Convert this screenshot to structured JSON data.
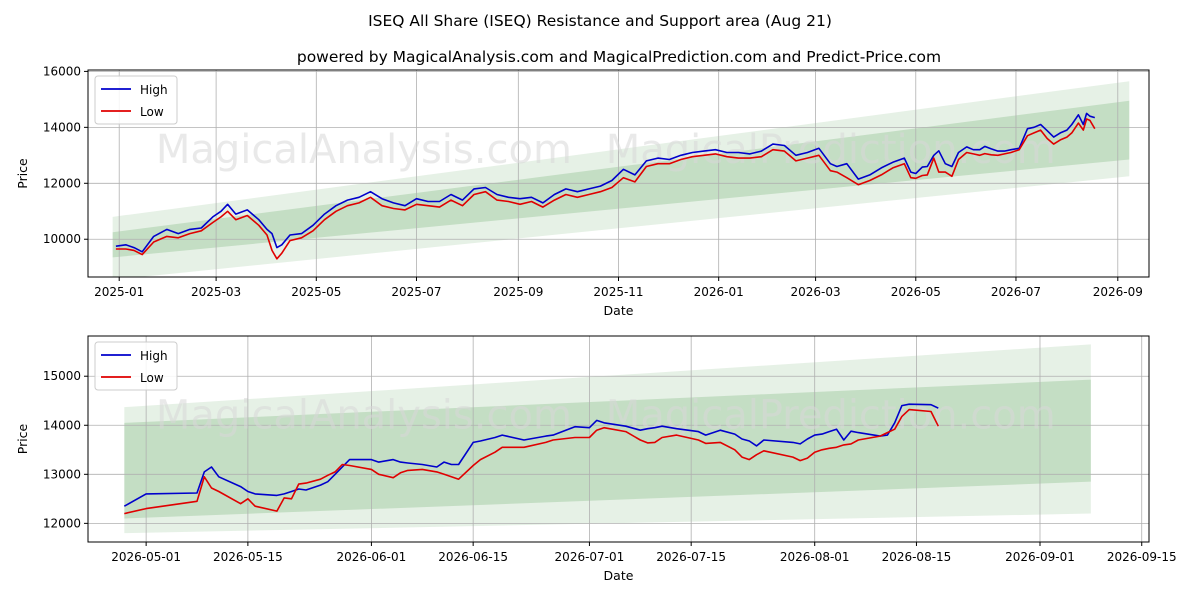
{
  "title": "ISEQ All Share (ISEQ) Resistance and Support area (Aug 21)",
  "subtitle": "powered by MagicalAnalysis.com and MagicalPrediction.com and Predict-Price.com",
  "watermark_left": "MagicalAnalysis.com",
  "watermark_right": "MagicalPrediction.com",
  "colors": {
    "high": "#0000cc",
    "low": "#e00000",
    "band": "#2e8b2e",
    "grid": "#b0b0b0"
  },
  "chart_data": [
    {
      "type": "line",
      "xlabel": "Date",
      "ylabel": "Price",
      "xlim": [
        "2024-12-13",
        "2026-09-20"
      ],
      "ylim": [
        8650,
        16050
      ],
      "xticks": [
        "2025-01",
        "2025-03",
        "2025-05",
        "2025-07",
        "2025-09",
        "2025-11",
        "2026-01",
        "2026-03",
        "2026-05",
        "2026-07",
        "2026-09"
      ],
      "yticks": [
        10000,
        12000,
        14000,
        16000
      ],
      "legend": [
        "High",
        "Low"
      ],
      "legend_position": "upper-left",
      "grid": true,
      "bands": [
        {
          "x": [
            "2024-12-28",
            "2026-09-08"
          ],
          "lower": [
            8550,
            12250
          ],
          "upper": [
            10800,
            15650
          ],
          "opacity": 0.12
        },
        {
          "x": [
            "2024-12-28",
            "2026-09-08"
          ],
          "lower": [
            9350,
            12850
          ],
          "upper": [
            10250,
            14950
          ],
          "opacity": 0.18
        }
      ],
      "series": [
        {
          "name": "High",
          "x": [
            "2024-12-30",
            "2025-01-05",
            "2025-01-10",
            "2025-01-15",
            "2025-01-22",
            "2025-01-30",
            "2025-02-06",
            "2025-02-13",
            "2025-02-20",
            "2025-02-27",
            "2025-03-04",
            "2025-03-08",
            "2025-03-13",
            "2025-03-20",
            "2025-03-27",
            "2025-04-01",
            "2025-04-04",
            "2025-04-07",
            "2025-04-10",
            "2025-04-15",
            "2025-04-22",
            "2025-04-29",
            "2025-05-06",
            "2025-05-13",
            "2025-05-20",
            "2025-05-27",
            "2025-06-03",
            "2025-06-10",
            "2025-06-17",
            "2025-06-24",
            "2025-07-01",
            "2025-07-08",
            "2025-07-15",
            "2025-07-22",
            "2025-07-29",
            "2025-08-05",
            "2025-08-12",
            "2025-08-19",
            "2025-08-26",
            "2025-09-02",
            "2025-09-09",
            "2025-09-16",
            "2025-09-23",
            "2025-09-30",
            "2025-10-07",
            "2025-10-14",
            "2025-10-21",
            "2025-10-28",
            "2025-11-04",
            "2025-11-11",
            "2025-11-18",
            "2025-11-25",
            "2025-12-02",
            "2025-12-09",
            "2025-12-16",
            "2025-12-23",
            "2025-12-30",
            "2026-01-06",
            "2026-01-13",
            "2026-01-20",
            "2026-01-27",
            "2026-02-03",
            "2026-02-10",
            "2026-02-17",
            "2026-02-24",
            "2026-03-03",
            "2026-03-10",
            "2026-03-14",
            "2026-03-20",
            "2026-03-27",
            "2026-04-03",
            "2026-04-10",
            "2026-04-17",
            "2026-04-24",
            "2026-04-28",
            "2026-05-01",
            "2026-05-05",
            "2026-05-08",
            "2026-05-12",
            "2026-05-15",
            "2026-05-19",
            "2026-05-23",
            "2026-05-27",
            "2026-06-01",
            "2026-06-05",
            "2026-06-09",
            "2026-06-12",
            "2026-06-16",
            "2026-06-20",
            "2026-06-24",
            "2026-06-28",
            "2026-07-03",
            "2026-07-08",
            "2026-07-12",
            "2026-07-16",
            "2026-07-20",
            "2026-07-24",
            "2026-07-28",
            "2026-08-01",
            "2026-08-04",
            "2026-08-08",
            "2026-08-11",
            "2026-08-13",
            "2026-08-15",
            "2026-08-18"
          ],
          "values": [
            9750,
            9800,
            9700,
            9550,
            10100,
            10350,
            10200,
            10350,
            10400,
            10800,
            11000,
            11250,
            10900,
            11050,
            10700,
            10350,
            10200,
            9700,
            9800,
            10150,
            10200,
            10500,
            10900,
            11200,
            11400,
            11500,
            11700,
            11450,
            11300,
            11200,
            11450,
            11350,
            11350,
            11600,
            11400,
            11800,
            11850,
            11600,
            11500,
            11450,
            11500,
            11300,
            11600,
            11800,
            11700,
            11800,
            11900,
            12100,
            12500,
            12300,
            12800,
            12900,
            12850,
            13000,
            13100,
            13150,
            13200,
            13100,
            13100,
            13050,
            13150,
            13400,
            13350,
            13000,
            13100,
            13250,
            12700,
            12600,
            12700,
            12150,
            12300,
            12550,
            12750,
            12900,
            12400,
            12350,
            12580,
            12600,
            13000,
            13160,
            12700,
            12600,
            13100,
            13300,
            13200,
            13200,
            13320,
            13230,
            13150,
            13150,
            13200,
            13250,
            13950,
            14000,
            14100,
            13880,
            13650,
            13800,
            13900,
            14100,
            14450,
            14100,
            14500,
            14400,
            14350
          ]
        },
        {
          "name": "Low",
          "x": [
            "2024-12-30",
            "2025-01-05",
            "2025-01-10",
            "2025-01-15",
            "2025-01-22",
            "2025-01-30",
            "2025-02-06",
            "2025-02-13",
            "2025-02-20",
            "2025-02-27",
            "2025-03-04",
            "2025-03-08",
            "2025-03-13",
            "2025-03-20",
            "2025-03-27",
            "2025-04-01",
            "2025-04-04",
            "2025-04-07",
            "2025-04-10",
            "2025-04-15",
            "2025-04-22",
            "2025-04-29",
            "2025-05-06",
            "2025-05-13",
            "2025-05-20",
            "2025-05-27",
            "2025-06-03",
            "2025-06-10",
            "2025-06-17",
            "2025-06-24",
            "2025-07-01",
            "2025-07-08",
            "2025-07-15",
            "2025-07-22",
            "2025-07-29",
            "2025-08-05",
            "2025-08-12",
            "2025-08-19",
            "2025-08-26",
            "2025-09-02",
            "2025-09-09",
            "2025-09-16",
            "2025-09-23",
            "2025-09-30",
            "2025-10-07",
            "2025-10-14",
            "2025-10-21",
            "2025-10-28",
            "2025-11-04",
            "2025-11-11",
            "2025-11-18",
            "2025-11-25",
            "2025-12-02",
            "2025-12-09",
            "2025-12-16",
            "2025-12-23",
            "2025-12-30",
            "2026-01-06",
            "2026-01-13",
            "2026-01-20",
            "2026-01-27",
            "2026-02-03",
            "2026-02-10",
            "2026-02-17",
            "2026-02-24",
            "2026-03-03",
            "2026-03-10",
            "2026-03-14",
            "2026-03-20",
            "2026-03-27",
            "2026-04-03",
            "2026-04-10",
            "2026-04-17",
            "2026-04-24",
            "2026-04-28",
            "2026-05-01",
            "2026-05-05",
            "2026-05-08",
            "2026-05-12",
            "2026-05-15",
            "2026-05-19",
            "2026-05-23",
            "2026-05-27",
            "2026-06-01",
            "2026-06-05",
            "2026-06-09",
            "2026-06-12",
            "2026-06-16",
            "2026-06-20",
            "2026-06-24",
            "2026-06-28",
            "2026-07-03",
            "2026-07-08",
            "2026-07-12",
            "2026-07-16",
            "2026-07-20",
            "2026-07-24",
            "2026-07-28",
            "2026-08-01",
            "2026-08-04",
            "2026-08-08",
            "2026-08-11",
            "2026-08-13",
            "2026-08-15",
            "2026-08-18"
          ],
          "values": [
            9650,
            9650,
            9600,
            9450,
            9900,
            10100,
            10050,
            10200,
            10300,
            10600,
            10800,
            11000,
            10700,
            10850,
            10500,
            10150,
            9600,
            9300,
            9500,
            9950,
            10050,
            10300,
            10700,
            11000,
            11200,
            11300,
            11500,
            11200,
            11100,
            11050,
            11250,
            11200,
            11150,
            11400,
            11200,
            11600,
            11700,
            11400,
            11350,
            11250,
            11350,
            11150,
            11400,
            11600,
            11500,
            11600,
            11700,
            11850,
            12200,
            12050,
            12600,
            12700,
            12700,
            12850,
            12950,
            13000,
            13050,
            12950,
            12900,
            12900,
            12950,
            13200,
            13150,
            12800,
            12900,
            13000,
            12450,
            12400,
            12200,
            11950,
            12100,
            12300,
            12550,
            12700,
            12200,
            12180,
            12280,
            12300,
            12900,
            12400,
            12400,
            12250,
            12850,
            13100,
            13050,
            13000,
            13060,
            13020,
            13000,
            13050,
            13100,
            13200,
            13700,
            13800,
            13900,
            13600,
            13400,
            13550,
            13650,
            13800,
            14150,
            13900,
            14300,
            14250,
            13950
          ]
        }
      ]
    },
    {
      "type": "line",
      "xlabel": "Date",
      "ylabel": "Price",
      "xlim": [
        "2026-04-23",
        "2026-09-16"
      ],
      "ylim": [
        11620,
        15820
      ],
      "xticks": [
        "2026-05-01",
        "2026-05-15",
        "2026-06-01",
        "2026-06-15",
        "2026-07-01",
        "2026-07-15",
        "2026-08-01",
        "2026-08-15",
        "2026-09-01",
        "2026-09-15"
      ],
      "yticks": [
        12000,
        13000,
        14000,
        15000
      ],
      "legend": [
        "High",
        "Low"
      ],
      "legend_position": "upper-left",
      "grid": true,
      "bands": [
        {
          "x": [
            "2026-04-28",
            "2026-09-08"
          ],
          "lower": [
            11800,
            12200
          ],
          "upper": [
            14370,
            15650
          ],
          "opacity": 0.12
        },
        {
          "x": [
            "2026-04-28",
            "2026-09-08"
          ],
          "lower": [
            12100,
            12850
          ],
          "upper": [
            14050,
            14930
          ],
          "opacity": 0.18
        }
      ],
      "series": [
        {
          "name": "High",
          "x": [
            "2026-04-28",
            "2026-05-01",
            "2026-05-08",
            "2026-05-09",
            "2026-05-10",
            "2026-05-11",
            "2026-05-14",
            "2026-05-15",
            "2026-05-16",
            "2026-05-19",
            "2026-05-20",
            "2026-05-21",
            "2026-05-22",
            "2026-05-23",
            "2026-05-25",
            "2026-05-26",
            "2026-05-27",
            "2026-05-28",
            "2026-05-29",
            "2026-06-01",
            "2026-06-02",
            "2026-06-04",
            "2026-06-05",
            "2026-06-06",
            "2026-06-08",
            "2026-06-10",
            "2026-06-11",
            "2026-06-12",
            "2026-06-13",
            "2026-06-15",
            "2026-06-16",
            "2026-06-18",
            "2026-06-19",
            "2026-06-22",
            "2026-06-25",
            "2026-06-26",
            "2026-06-29",
            "2026-07-01",
            "2026-07-02",
            "2026-07-03",
            "2026-07-06",
            "2026-07-08",
            "2026-07-09",
            "2026-07-10",
            "2026-07-11",
            "2026-07-13",
            "2026-07-16",
            "2026-07-17",
            "2026-07-19",
            "2026-07-21",
            "2026-07-22",
            "2026-07-23",
            "2026-07-24",
            "2026-07-25",
            "2026-07-29",
            "2026-07-30",
            "2026-07-31",
            "2026-08-01",
            "2026-08-02",
            "2026-08-03",
            "2026-08-04",
            "2026-08-05",
            "2026-08-06",
            "2026-08-07",
            "2026-08-10",
            "2026-08-11",
            "2026-08-12",
            "2026-08-13",
            "2026-08-14",
            "2026-08-17",
            "2026-08-18"
          ],
          "values": [
            12350,
            12600,
            12620,
            13050,
            13150,
            12950,
            12750,
            12650,
            12600,
            12570,
            12600,
            12650,
            12700,
            12680,
            12780,
            12850,
            13000,
            13150,
            13300,
            13300,
            13250,
            13300,
            13250,
            13230,
            13200,
            13150,
            13250,
            13200,
            13200,
            13650,
            13680,
            13750,
            13800,
            13700,
            13780,
            13800,
            13970,
            13950,
            14100,
            14050,
            13980,
            13900,
            13930,
            13950,
            13980,
            13930,
            13870,
            13800,
            13900,
            13820,
            13720,
            13680,
            13580,
            13700,
            13650,
            13620,
            13720,
            13800,
            13820,
            13870,
            13920,
            13700,
            13880,
            13850,
            13780,
            13800,
            14050,
            14400,
            14430,
            14420,
            14350
          ]
        },
        {
          "name": "Low",
          "x": [
            "2026-04-28",
            "2026-05-01",
            "2026-05-08",
            "2026-05-09",
            "2026-05-10",
            "2026-05-11",
            "2026-05-14",
            "2026-05-15",
            "2026-05-16",
            "2026-05-19",
            "2026-05-20",
            "2026-05-21",
            "2026-05-22",
            "2026-05-23",
            "2026-05-25",
            "2026-05-26",
            "2026-05-27",
            "2026-05-28",
            "2026-05-29",
            "2026-06-01",
            "2026-06-02",
            "2026-06-04",
            "2026-06-05",
            "2026-06-06",
            "2026-06-08",
            "2026-06-10",
            "2026-06-11",
            "2026-06-12",
            "2026-06-13",
            "2026-06-15",
            "2026-06-16",
            "2026-06-18",
            "2026-06-19",
            "2026-06-22",
            "2026-06-25",
            "2026-06-26",
            "2026-06-29",
            "2026-07-01",
            "2026-07-02",
            "2026-07-03",
            "2026-07-06",
            "2026-07-08",
            "2026-07-09",
            "2026-07-10",
            "2026-07-11",
            "2026-07-13",
            "2026-07-16",
            "2026-07-17",
            "2026-07-19",
            "2026-07-21",
            "2026-07-22",
            "2026-07-23",
            "2026-07-24",
            "2026-07-25",
            "2026-07-29",
            "2026-07-30",
            "2026-07-31",
            "2026-08-01",
            "2026-08-02",
            "2026-08-03",
            "2026-08-04",
            "2026-08-05",
            "2026-08-06",
            "2026-08-07",
            "2026-08-10",
            "2026-08-11",
            "2026-08-12",
            "2026-08-13",
            "2026-08-14",
            "2026-08-17",
            "2026-08-18"
          ],
          "values": [
            12200,
            12300,
            12450,
            12950,
            12720,
            12650,
            12400,
            12500,
            12350,
            12250,
            12520,
            12500,
            12800,
            12820,
            12900,
            12980,
            13050,
            13200,
            13180,
            13100,
            13000,
            12930,
            13030,
            13080,
            13100,
            13050,
            13000,
            12950,
            12900,
            13180,
            13300,
            13450,
            13550,
            13550,
            13650,
            13700,
            13750,
            13750,
            13900,
            13950,
            13870,
            13700,
            13640,
            13650,
            13750,
            13800,
            13700,
            13630,
            13650,
            13500,
            13350,
            13300,
            13400,
            13480,
            13350,
            13280,
            13330,
            13450,
            13500,
            13530,
            13550,
            13600,
            13620,
            13700,
            13780,
            13850,
            13920,
            14180,
            14320,
            14280,
            13980
          ]
        }
      ]
    }
  ]
}
